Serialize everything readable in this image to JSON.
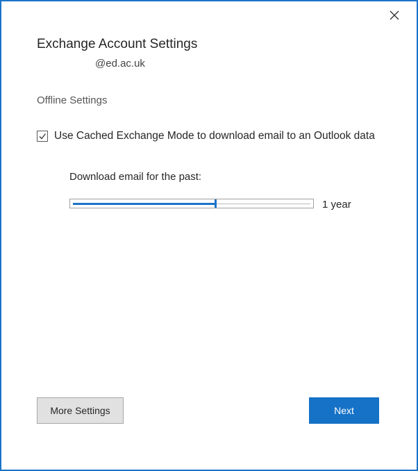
{
  "dialog": {
    "title": "Exchange Account Settings",
    "email": "@ed.ac.uk",
    "section_heading": "Offline Settings",
    "cached_mode": {
      "label": "Use Cached Exchange Mode to download email to an Outlook data",
      "checked": true
    },
    "download": {
      "label": "Download email for the past:",
      "value_label": "1 year",
      "slider_fraction": 0.6
    },
    "buttons": {
      "more_settings": "More Settings",
      "next": "Next"
    }
  },
  "colors": {
    "accent": "#1572c6",
    "border": "#1a73c8"
  },
  "icons": {
    "close": "close-icon",
    "check": "checkmark-icon"
  }
}
